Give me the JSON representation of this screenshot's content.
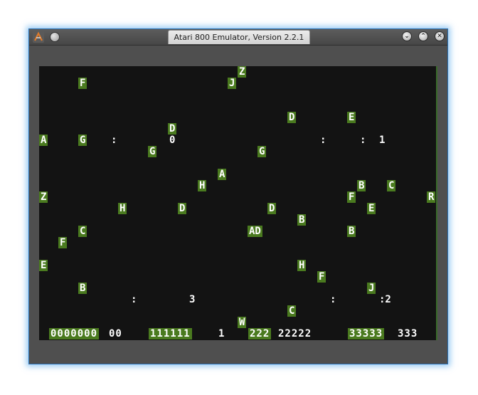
{
  "window": {
    "title": "Atari 800 Emulator, Version 2.2.1"
  },
  "titlebar_buttons": {
    "minimize": "⌄",
    "maximize": "⌃",
    "close": "✕"
  },
  "screen": {
    "letters": [
      {
        "ch": "Z",
        "inv": true
      },
      {
        "ch": "F",
        "inv": true
      },
      {
        "ch": "J",
        "inv": true
      },
      {
        "ch": "D",
        "inv": true
      },
      {
        "ch": "E",
        "inv": true
      },
      {
        "ch": "D",
        "inv": true
      },
      {
        "ch": "A",
        "inv": true
      },
      {
        "ch": "G",
        "inv": true
      },
      {
        "ch": ":",
        "inv": false
      },
      {
        "ch": "0",
        "inv": false
      },
      {
        "ch": ":",
        "inv": false
      },
      {
        "ch": ":",
        "inv": false
      },
      {
        "ch": "1",
        "inv": false
      },
      {
        "ch": "G",
        "inv": true
      },
      {
        "ch": "G",
        "inv": true
      },
      {
        "ch": "A",
        "inv": true
      },
      {
        "ch": "H",
        "inv": true
      },
      {
        "ch": "B",
        "inv": true
      },
      {
        "ch": "C",
        "inv": true
      },
      {
        "ch": "Z",
        "inv": true
      },
      {
        "ch": "F",
        "inv": true
      },
      {
        "ch": "R",
        "inv": true
      },
      {
        "ch": "H",
        "inv": true
      },
      {
        "ch": "D",
        "inv": true
      },
      {
        "ch": "D",
        "inv": true
      },
      {
        "ch": "E",
        "inv": true
      },
      {
        "ch": "B",
        "inv": true
      },
      {
        "ch": "C",
        "inv": true
      },
      {
        "ch": "AD",
        "inv": true
      },
      {
        "ch": "B",
        "inv": true
      },
      {
        "ch": "F",
        "inv": true
      },
      {
        "ch": "E",
        "inv": true
      },
      {
        "ch": "H",
        "inv": true
      },
      {
        "ch": "F",
        "inv": true
      },
      {
        "ch": "B",
        "inv": true
      },
      {
        "ch": "J",
        "inv": true
      },
      {
        "ch": ":",
        "inv": false
      },
      {
        "ch": "3",
        "inv": false
      },
      {
        "ch": ":",
        "inv": false
      },
      {
        "ch": ":2",
        "inv": false
      },
      {
        "ch": "C",
        "inv": true
      },
      {
        "ch": "W",
        "inv": true
      }
    ],
    "bottom_row": [
      {
        "text": "0000000",
        "inv": true
      },
      {
        "text": "00",
        "inv": false
      },
      {
        "text": "111111",
        "inv": true
      },
      {
        "text": "1",
        "inv": false
      },
      {
        "text": "222",
        "inv": true
      },
      {
        "text": "22222",
        "inv": false
      },
      {
        "text": "33333",
        "inv": true
      },
      {
        "text": "333",
        "inv": false
      }
    ]
  }
}
